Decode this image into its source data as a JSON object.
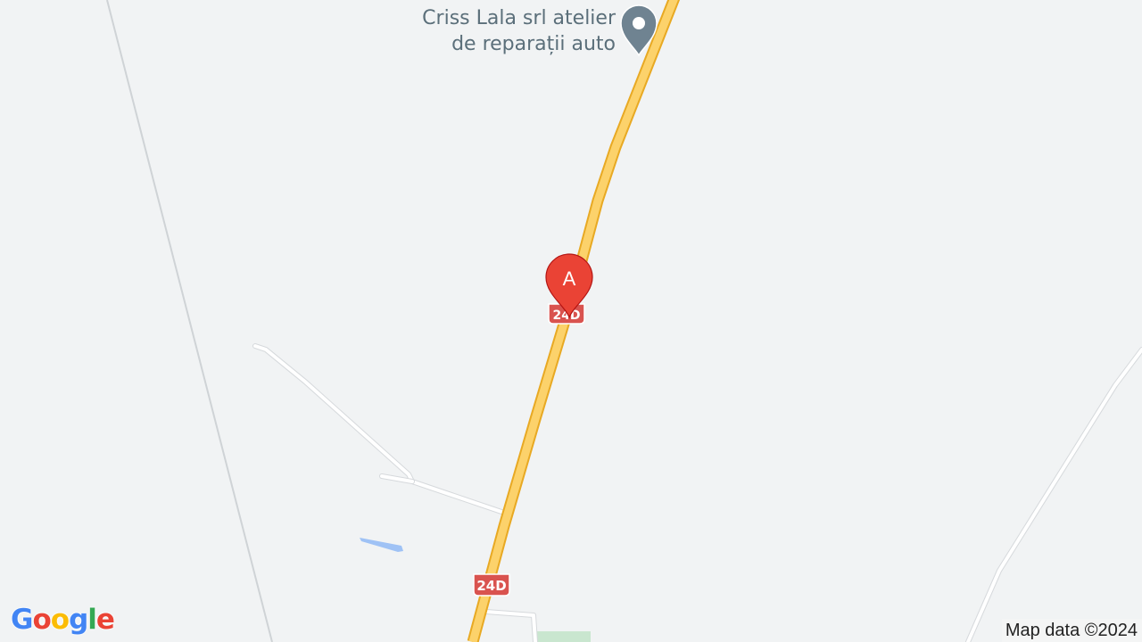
{
  "map": {
    "poi": {
      "name_line1": "Criss Lala srl atelier",
      "name_line2": "de reparații auto",
      "icon": "place-pin-icon",
      "color": "#6f8391"
    },
    "marker": {
      "label": "A",
      "color": "#ea4335",
      "icon": "map-marker-icon"
    },
    "route_shields": [
      {
        "label": "24D",
        "color": "#d9534f"
      },
      {
        "label": "24D",
        "color": "#d9534f"
      }
    ],
    "colors": {
      "background": "#f1f3f4",
      "highway_fill": "#fcd26b",
      "highway_casing": "#e8a923",
      "minor_road": "#ffffff",
      "water": "#9fc2f5",
      "park": "#c9e6cf"
    }
  },
  "branding": {
    "logo": {
      "letters": [
        "G",
        "o",
        "o",
        "g",
        "l",
        "e"
      ],
      "colors": [
        "#4285f4",
        "#ea4335",
        "#fbbc05",
        "#4285f4",
        "#34a853",
        "#ea4335"
      ]
    },
    "attribution": "Map data ©2024"
  }
}
